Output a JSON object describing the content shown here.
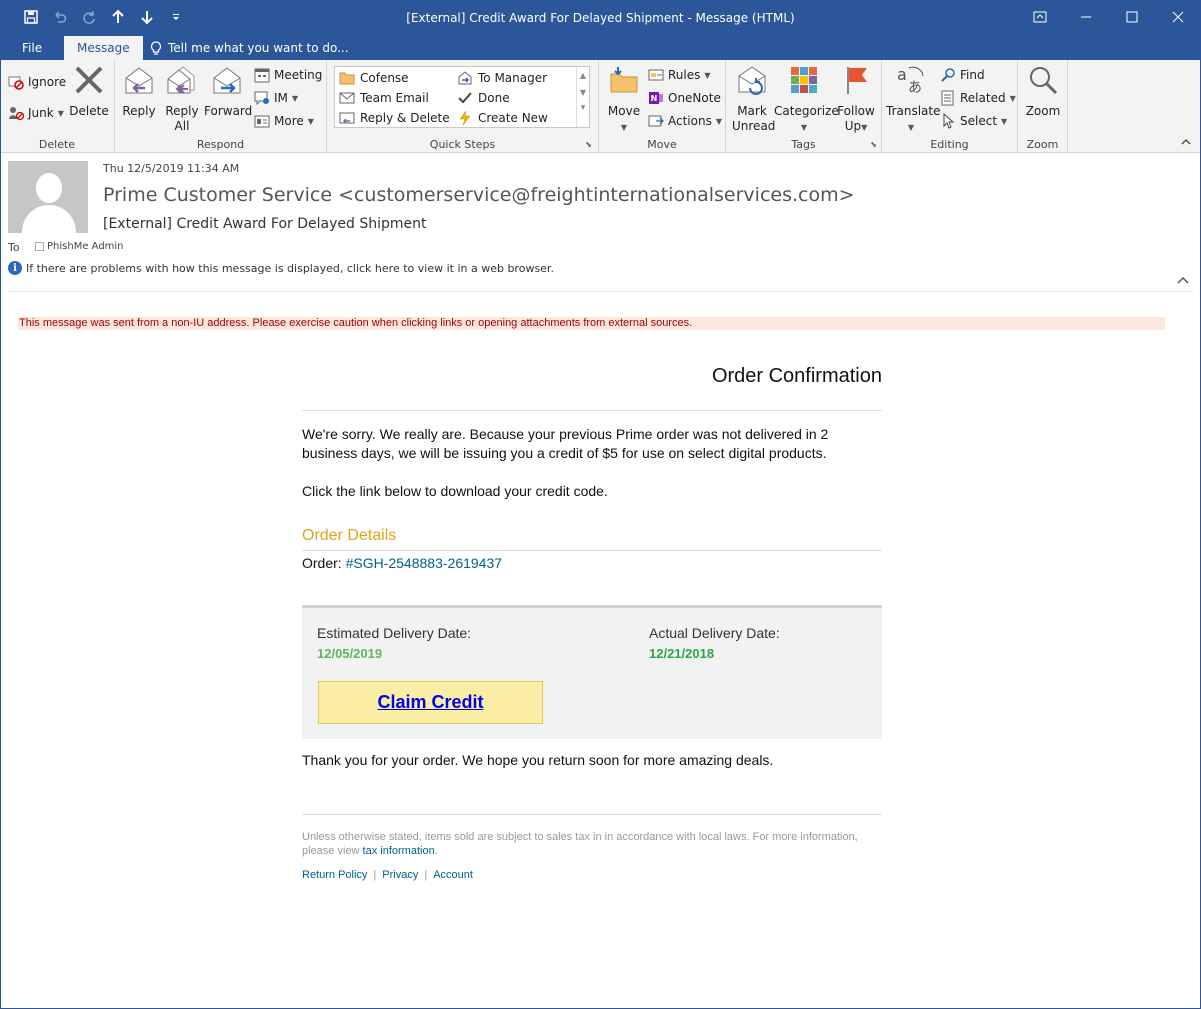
{
  "window": {
    "title": "[External] Credit Award For Delayed Shipment - Message (HTML)",
    "accent": "#2b579a"
  },
  "qat": {
    "save_icon": "save-icon",
    "undo_icon": "undo-icon",
    "redo_icon": "redo-icon",
    "up_icon": "arrow-up-icon",
    "down_icon": "arrow-down-icon",
    "customize_icon": "customize-icon"
  },
  "tabs": {
    "file": "File",
    "message": "Message",
    "tellme": "Tell me what you want to do..."
  },
  "ribbon": {
    "delete_group": {
      "label": "Delete",
      "ignore": "Ignore",
      "junk": "Junk",
      "delete": "Delete"
    },
    "respond_group": {
      "label": "Respond",
      "reply": "Reply",
      "reply_all_1": "Reply",
      "reply_all_2": "All",
      "forward": "Forward",
      "meeting": "Meeting",
      "im": "IM",
      "more": "More"
    },
    "quicksteps_group": {
      "label": "Quick Steps",
      "cofense": "Cofense",
      "team_email": "Team Email",
      "reply_delete": "Reply & Delete",
      "to_manager": "To Manager",
      "done": "Done",
      "create_new": "Create New"
    },
    "move_group": {
      "label": "Move",
      "move": "Move",
      "rules": "Rules",
      "onenote": "OneNote",
      "actions": "Actions"
    },
    "tags_group": {
      "label": "Tags",
      "mark_unread_1": "Mark",
      "mark_unread_2": "Unread",
      "categorize": "Categorize",
      "follow_up_1": "Follow",
      "follow_up_2": "Up"
    },
    "editing_group": {
      "label": "Editing",
      "translate": "Translate",
      "find": "Find",
      "related": "Related",
      "select": "Select"
    },
    "zoom_group": {
      "label": "Zoom",
      "zoom": "Zoom"
    }
  },
  "header": {
    "date": "Thu 12/5/2019 11:34 AM",
    "from": "Prime Customer Service <customerservice@freightinternationalservices.com>",
    "subject": "[External] Credit Award For Delayed Shipment",
    "to_label": "To",
    "to": "PhishMe Admin",
    "info": "If there are problems with how this message is displayed, click here to view it in a web browser."
  },
  "body": {
    "warning": "This message was sent from a non-IU address. Please exercise caution when clicking links or opening attachments from external sources.",
    "order_title": "Order Confirmation",
    "intro": "We're sorry.  We really are.  Because your previous Prime order was not delivered in 2 business days, we will be issuing you a credit of $5 for use on select digital products.",
    "link_line": "Click the link below to download your credit code.",
    "order_details_title": "Order Details",
    "order_label": "Order: ",
    "order_number": "#SGH-2548883-2619437",
    "estimated_label": "Estimated Delivery Date:",
    "estimated_value": "12/05/2019",
    "actual_label": "Actual Delivery Date:",
    "actual_value": "12/21/2018",
    "claim_button": "Claim Credit",
    "thanks": "Thank you for your order. We hope you return soon for more amazing deals.",
    "fineprint_1": "Unless otherwise stated, items sold are subject to sales tax in in accordance with local laws. For more information, please view ",
    "fineprint_link": "tax information",
    "fineprint_2": ".",
    "footer_return": "Return Policy",
    "footer_privacy": "Privacy",
    "footer_account": "Account",
    "footer_sep": "|"
  }
}
